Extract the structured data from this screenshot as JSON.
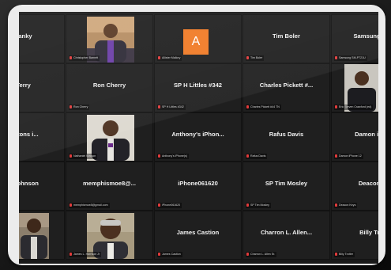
{
  "tiles": [
    {
      "name": "...panky",
      "label": ""
    },
    {
      "name": "",
      "label": "Christopher Barnett"
    },
    {
      "name": "A",
      "label": "Allister Mallory",
      "avatar_letter": "A",
      "avatar_color": "#f07a25"
    },
    {
      "name": "Tim Boler",
      "label": "Tim Boler"
    },
    {
      "name": "Samsung SM...",
      "label": "Samsung SM-P721U"
    },
    {
      "name": "...Terry",
      "label": ""
    },
    {
      "name": "Ron Cherry",
      "label": "Ron Cherry"
    },
    {
      "name": "SP H Littles #342",
      "label": "SP H Littles #342"
    },
    {
      "name": "Charles Pickett #...",
      "label": "Charles Pickett #44 TN"
    },
    {
      "name": "",
      "label": "Eric Steven Crawford (ed)"
    },
    {
      "name": "...vertons i...",
      "label": ""
    },
    {
      "name": "",
      "label": "Nathaniel Watson"
    },
    {
      "name": "Anthony's iPhon...",
      "label": "Anthony's iPhone(s)"
    },
    {
      "name": "Rafus Davis",
      "label": "Rafus Davis"
    },
    {
      "name": "Damon iPho...",
      "label": "Damon iPhone 12"
    },
    {
      "name": "...o Johnson",
      "label": ""
    },
    {
      "name": "memphismoe8@...",
      "label": "memphismoe8@gmail.com"
    },
    {
      "name": "iPhone061620",
      "label": "iPhone061620"
    },
    {
      "name": "SP Tim Mosley",
      "label": "SP Tim Mosley"
    },
    {
      "name": "Deacon K...",
      "label": "Deacon Keys"
    },
    {
      "name": "",
      "label": ""
    },
    {
      "name": "",
      "label": "James L. Harrison Jr"
    },
    {
      "name": "James Castion",
      "label": "James Castion"
    },
    {
      "name": "Charron L. Allen...",
      "label": "Charron L. Allen Sr."
    },
    {
      "name": "Billy Trot...",
      "label": "Billy Trotter"
    }
  ]
}
